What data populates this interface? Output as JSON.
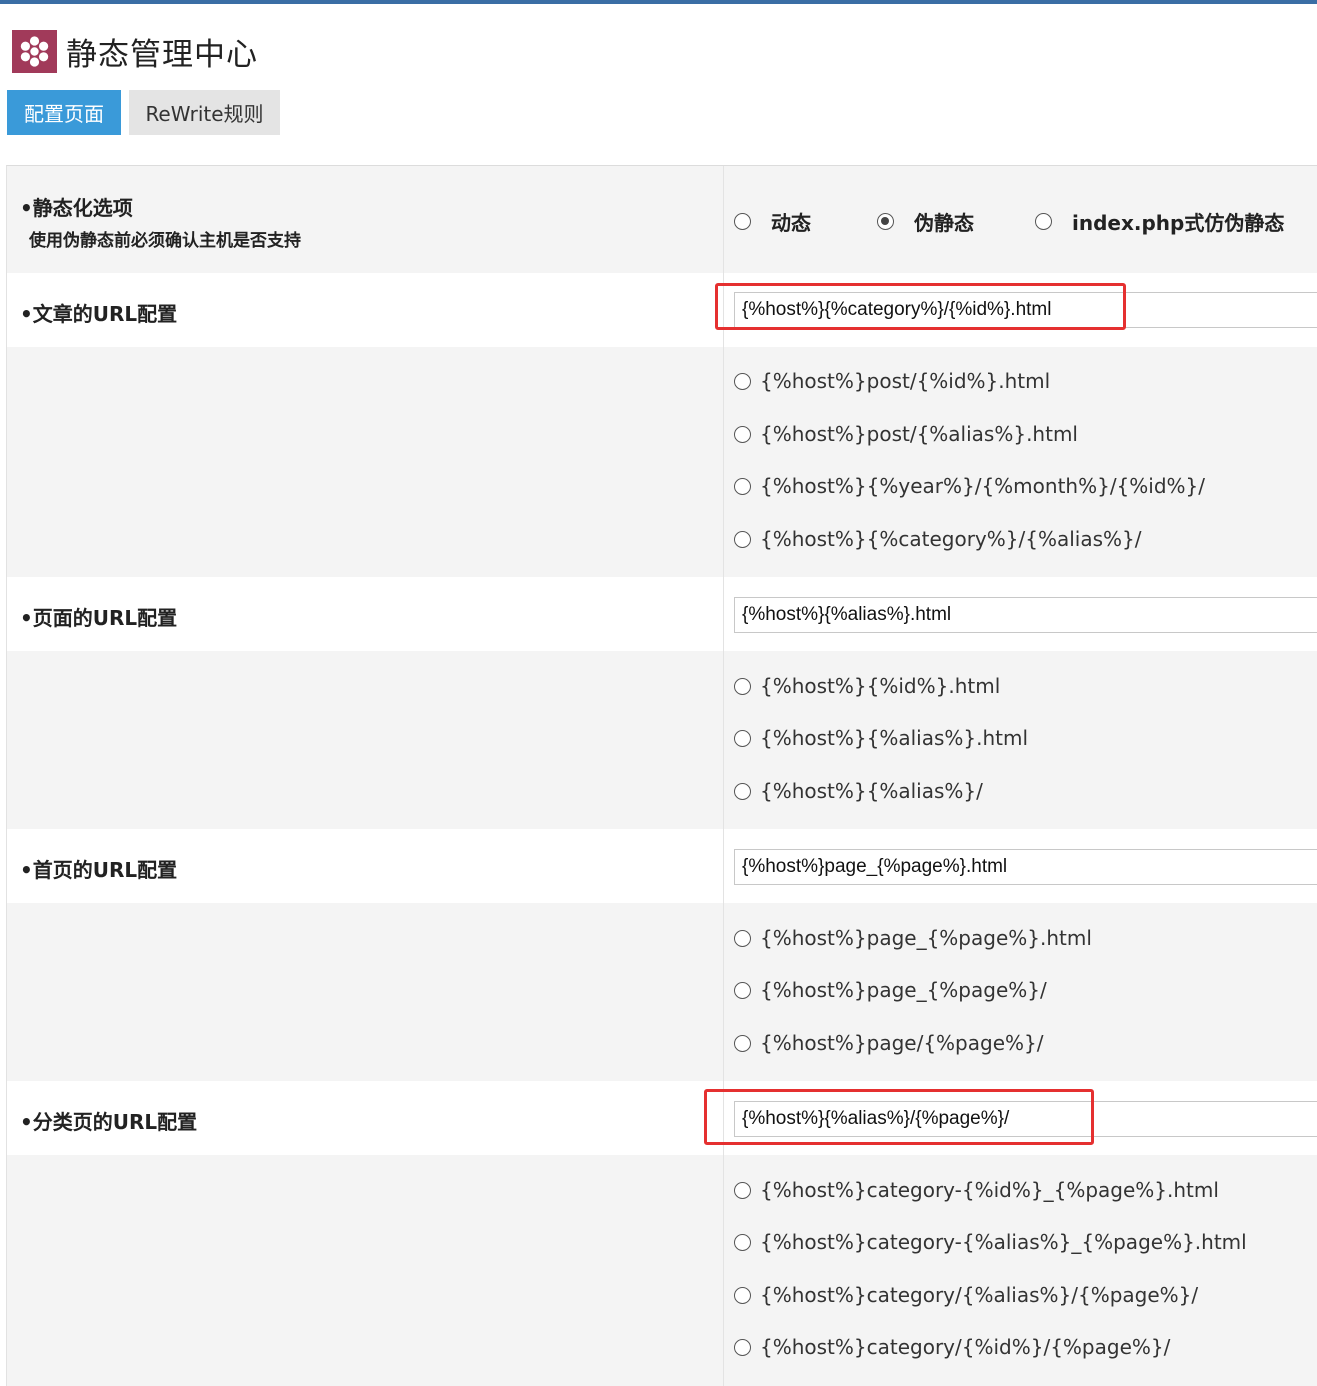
{
  "app": {
    "title": "静态管理中心",
    "logo_icon": "flower-icon",
    "logo_color": "#a13a5a"
  },
  "tabs": [
    {
      "label": "配置页面",
      "active": true
    },
    {
      "label": "ReWrite规则",
      "active": false
    }
  ],
  "static_mode": {
    "label": "•静态化选项",
    "hint": "使用伪静态前必须确认主机是否支持",
    "options": [
      {
        "label": "动态",
        "checked": false
      },
      {
        "label": "伪静态",
        "checked": true
      },
      {
        "label": "index.php式仿伪静态",
        "checked": false
      }
    ]
  },
  "article": {
    "label": "•文章的URL配置",
    "value": "{%host%}{%category%}/{%id%}.html",
    "options": [
      "{%host%}post/{%id%}.html",
      "{%host%}post/{%alias%}.html",
      "{%host%}{%year%}/{%month%}/{%id%}/",
      "{%host%}{%category%}/{%alias%}/"
    ]
  },
  "page": {
    "label": "•页面的URL配置",
    "value": "{%host%}{%alias%}.html",
    "options": [
      "{%host%}{%id%}.html",
      "{%host%}{%alias%}.html",
      "{%host%}{%alias%}/"
    ]
  },
  "index": {
    "label": "•首页的URL配置",
    "value": "{%host%}page_{%page%}.html",
    "options": [
      "{%host%}page_{%page%}.html",
      "{%host%}page_{%page%}/",
      "{%host%}page/{%page%}/"
    ]
  },
  "category": {
    "label": "•分类页的URL配置",
    "value": "{%host%}{%alias%}/{%page%}/",
    "options": [
      "{%host%}category-{%id%}_{%page%}.html",
      "{%host%}category-{%alias%}_{%page%}.html",
      "{%host%}category/{%alias%}/{%page%}/",
      "{%host%}category/{%id%}/{%page%}/"
    ]
  },
  "colors": {
    "accent_tab": "#3a9ad9",
    "highlight_box": "#e53030"
  }
}
